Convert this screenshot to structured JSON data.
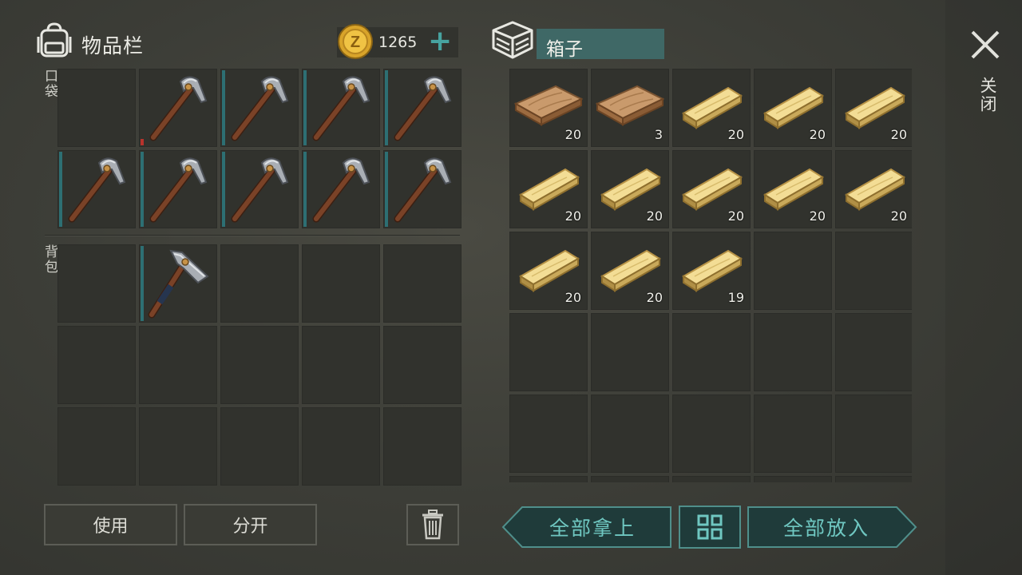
{
  "inventory": {
    "title": "物品栏",
    "coins": "1265",
    "plus_label": "+",
    "pocket_label": "口袋",
    "bag_label": "背包",
    "pocket_slots": [
      {
        "item": null
      },
      {
        "item": "pickaxe-icon",
        "durability": "low"
      },
      {
        "item": "pickaxe-icon",
        "durability": "full"
      },
      {
        "item": "pickaxe-icon",
        "durability": "full"
      },
      {
        "item": "pickaxe-icon",
        "durability": "full"
      },
      {
        "item": "pickaxe-icon",
        "durability": "full"
      },
      {
        "item": "pickaxe-icon",
        "durability": "full"
      },
      {
        "item": "pickaxe-icon",
        "durability": "full"
      },
      {
        "item": "pickaxe-icon",
        "durability": "full"
      },
      {
        "item": "pickaxe-icon",
        "durability": "full"
      }
    ],
    "bag_slots": [
      {
        "item": null
      },
      {
        "item": "hatchet-icon",
        "durability": "full"
      },
      {
        "item": null
      },
      {
        "item": null
      },
      {
        "item": null
      },
      {
        "item": null
      },
      {
        "item": null
      },
      {
        "item": null
      },
      {
        "item": null
      },
      {
        "item": null
      },
      {
        "item": null
      },
      {
        "item": null
      },
      {
        "item": null
      },
      {
        "item": null
      },
      {
        "item": null
      }
    ]
  },
  "container": {
    "title": "箱子",
    "slots": [
      {
        "item": "plank-rough-icon",
        "qty": "20"
      },
      {
        "item": "plank-rough-icon",
        "qty": "3"
      },
      {
        "item": "plank-icon",
        "qty": "20"
      },
      {
        "item": "plank-icon",
        "qty": "20"
      },
      {
        "item": "plank-icon",
        "qty": "20"
      },
      {
        "item": "plank-icon",
        "qty": "20"
      },
      {
        "item": "plank-icon",
        "qty": "20"
      },
      {
        "item": "plank-icon",
        "qty": "20"
      },
      {
        "item": "plank-icon",
        "qty": "20"
      },
      {
        "item": "plank-icon",
        "qty": "20"
      },
      {
        "item": "plank-icon",
        "qty": "20"
      },
      {
        "item": "plank-icon",
        "qty": "20"
      },
      {
        "item": "plank-icon",
        "qty": "19"
      },
      {
        "item": null
      },
      {
        "item": null
      },
      {
        "item": null
      },
      {
        "item": null
      },
      {
        "item": null
      },
      {
        "item": null
      },
      {
        "item": null
      },
      {
        "item": null
      },
      {
        "item": null
      },
      {
        "item": null
      },
      {
        "item": null
      },
      {
        "item": null
      },
      {
        "item": null
      },
      {
        "item": null
      },
      {
        "item": null
      },
      {
        "item": null
      },
      {
        "item": null
      }
    ]
  },
  "actions": {
    "use": "使用",
    "split": "分开",
    "take_all": "全部拿上",
    "put_all": "全部放入",
    "close": "关闭"
  },
  "colors": {
    "accent_teal": "#47a3a0",
    "durability_bar": "#2d6f73",
    "durability_low": "#b8332c",
    "title_bg": "#3f6866"
  }
}
